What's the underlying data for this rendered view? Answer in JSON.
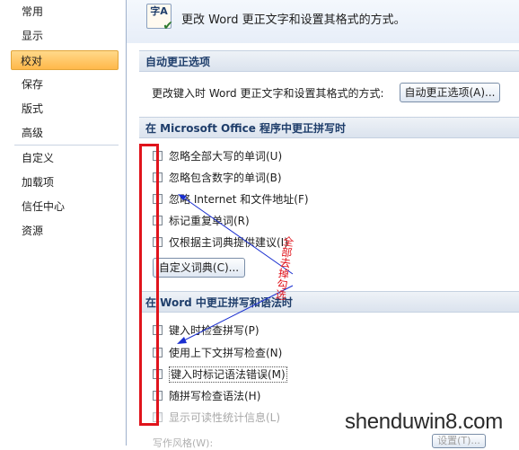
{
  "sidebar": {
    "items": [
      {
        "label": "常用"
      },
      {
        "label": "显示"
      },
      {
        "label": "校对",
        "active": true
      },
      {
        "label": "保存"
      },
      {
        "label": "版式"
      },
      {
        "label": "高级"
      },
      {
        "label": "自定义"
      },
      {
        "label": "加载项"
      },
      {
        "label": "信任中心"
      },
      {
        "label": "资源"
      }
    ]
  },
  "header": {
    "icon_text": "字A",
    "description": "更改 Word 更正文字和设置其格式的方式。"
  },
  "autocorrect": {
    "section_title": "自动更正选项",
    "row_label": "更改键入时 Word 更正文字和设置其格式的方式:",
    "button_label": "自动更正选项(A)..."
  },
  "office_spell": {
    "section_title": "在 Microsoft Office 程序中更正拼写时",
    "options": [
      {
        "label": "忽略全部大写的单词(U)",
        "checked": false
      },
      {
        "label": "忽略包含数字的单词(B)",
        "checked": false
      },
      {
        "label": "忽略 Internet 和文件地址(F)",
        "checked": false
      },
      {
        "label": "标记重复单词(R)",
        "checked": false
      },
      {
        "label": "仅根据主词典提供建议(I)",
        "checked": false
      }
    ],
    "custom_dict_button": "自定义词典(C)..."
  },
  "word_spell": {
    "section_title": "在 Word 中更正拼写和语法时",
    "options": [
      {
        "label": "键入时检查拼写(P)",
        "checked": false
      },
      {
        "label": "使用上下文拼写检查(N)",
        "checked": false
      },
      {
        "label": "键入时标记语法错误(M)",
        "checked": false
      },
      {
        "label": "随拼写检查语法(H)",
        "checked": false
      },
      {
        "label": "显示可读性统计信息(L)",
        "checked": false,
        "disabled": true
      }
    ],
    "writing_style_label": "写作风格(W):",
    "settings_button": "设置(T)..."
  },
  "annotation": {
    "text": "全部去掉勾选",
    "color": "#e0141c",
    "arrow_color": "#1a2fd0"
  },
  "watermark": {
    "text": "shenduwin8.com"
  }
}
